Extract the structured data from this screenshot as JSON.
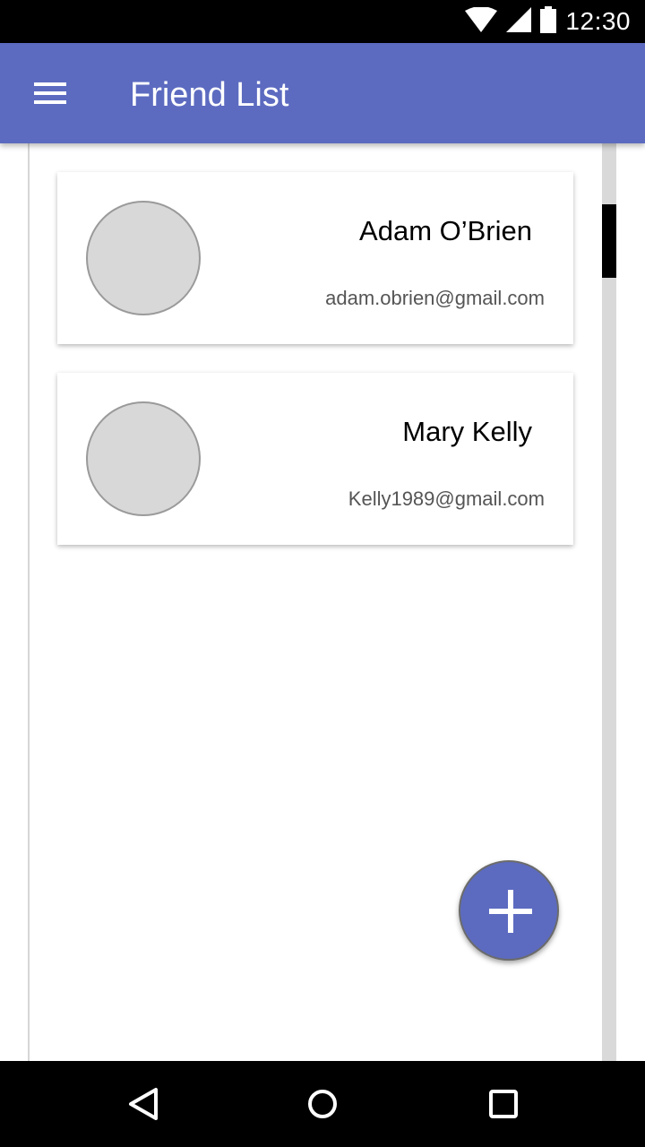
{
  "status_bar": {
    "time": "12:30",
    "icons": [
      "wifi-icon",
      "signal-icon",
      "battery-icon"
    ]
  },
  "app_bar": {
    "title": "Friend List",
    "menu_icon": "menu-icon"
  },
  "friends": [
    {
      "name": "Adam O’Brien",
      "email": "adam.obrien@gmail.com"
    },
    {
      "name": "Mary Kelly",
      "email": "Kelly1989@gmail.com"
    }
  ],
  "fab": {
    "icon": "plus-icon"
  },
  "nav_bar": {
    "icons": [
      "back-icon",
      "home-icon",
      "recents-icon"
    ]
  },
  "colors": {
    "primary": "#5c6bc0",
    "status_bar": "#000000",
    "avatar_fill": "#d8d8d8"
  }
}
